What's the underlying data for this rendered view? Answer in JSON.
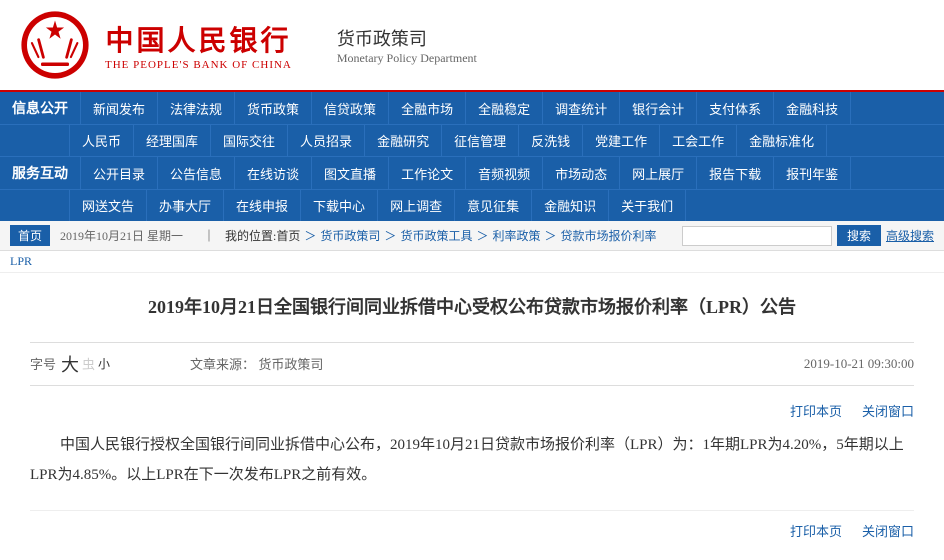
{
  "header": {
    "logo_cn": "中国人民银行",
    "logo_en": "THE PEOPLE'S BANK OF CHINA",
    "dept_cn": "货币政策司",
    "dept_en": "Monetary Policy Department"
  },
  "nav": {
    "section1_label": "信息公开",
    "section2_label": "服务互动",
    "row1": [
      "新闻发布",
      "法律法规",
      "货币政策",
      "信贷政策",
      "全融市场",
      "全融稳定",
      "调查统计",
      "银行会计",
      "支付体系",
      "金融科技"
    ],
    "row2": [
      "人民币",
      "经理国库",
      "国际交往",
      "人员招录",
      "金融研究",
      "征信管理",
      "反洗钱",
      "党建工作",
      "工会工作",
      "金融标准化"
    ],
    "row3": [
      "公开目录",
      "公告信息",
      "在线访谈",
      "图文直播",
      "工作论文",
      "音频视频",
      "市场动态",
      "网上展厅",
      "报告下载",
      "报刊年鉴"
    ],
    "row4": [
      "网送文告",
      "办事大厅",
      "在线申报",
      "下载中心",
      "网上调查",
      "意见征集",
      "金融知识",
      "关于我们"
    ]
  },
  "breadcrumb": {
    "home": "首页",
    "date": "2019年10月21日 星期一",
    "my_location": "我的位置:首页",
    "paths": [
      "货币政策司",
      "货币政策工具",
      "利率政策",
      "贷款市场报价利率",
      "LPR"
    ],
    "search_placeholder": "",
    "search_btn": "搜索",
    "adv_search": "高级搜索"
  },
  "article": {
    "title": "2019年10月21日全国银行间同业拆借中心受权公布贷款市场报价利率（LPR）公告",
    "font_label": "字号",
    "font_large": "大",
    "font_mid": "中",
    "font_small": "小",
    "source_label": "文章来源：",
    "source": "货币政策司",
    "date": "2019-10-21  09:30:00",
    "print": "打印本页",
    "close": "关闭窗口",
    "body": "中国人民银行授权全国银行间同业拆借中心公布，2019年10月21日贷款市场报价利率（LPR）为：1年期LPR为4.20%，5年期以上LPR为4.85%。以上LPR在下一次发布LPR之前有效。",
    "print2": "打印本页",
    "close2": "关闭窗口"
  }
}
